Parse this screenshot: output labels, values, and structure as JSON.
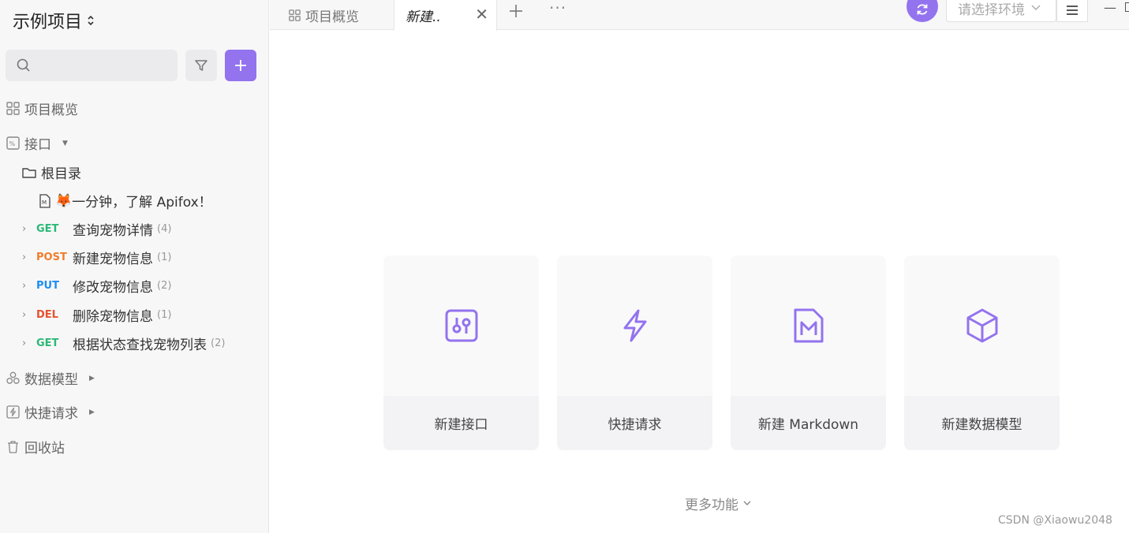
{
  "sidebar": {
    "project_title": "示例项目",
    "search": {
      "placeholder": ""
    },
    "nav": {
      "overview": "项目概览",
      "interface": "接口",
      "data_model": "数据模型",
      "quick_request": "快捷请求",
      "recycle": "回收站"
    },
    "tree": {
      "root": "根目录",
      "doc": {
        "emoji": "🦊",
        "label": "一分钟，了解 Apifox！"
      },
      "endpoints": [
        {
          "method": "GET",
          "color": "#2bb876",
          "name": "查询宠物详情",
          "count": "(4)"
        },
        {
          "method": "POST",
          "color": "#f17c2b",
          "name": "新建宠物信息",
          "count": "(1)"
        },
        {
          "method": "PUT",
          "color": "#1d8ef0",
          "name": "修改宠物信息",
          "count": "(2)"
        },
        {
          "method": "DEL",
          "color": "#e8512e",
          "name": "删除宠物信息",
          "count": "(1)"
        },
        {
          "method": "GET",
          "color": "#2bb876",
          "name": "根据状态查找宠物列表",
          "count": "(2)"
        }
      ]
    }
  },
  "tabs": {
    "overview": "项目概览",
    "new": "新建.."
  },
  "toolbar": {
    "env_placeholder": "请选择环境"
  },
  "cards": [
    {
      "label": "新建接口",
      "icon": "api-icon"
    },
    {
      "label": "快捷请求",
      "icon": "lightning-icon"
    },
    {
      "label": "新建 Markdown",
      "icon": "markdown-icon"
    },
    {
      "label": "新建数据模型",
      "icon": "cube-icon"
    }
  ],
  "more_functions": "更多功能",
  "watermark": "CSDN @Xiaowu2048",
  "colors": {
    "accent": "#9373ee"
  }
}
